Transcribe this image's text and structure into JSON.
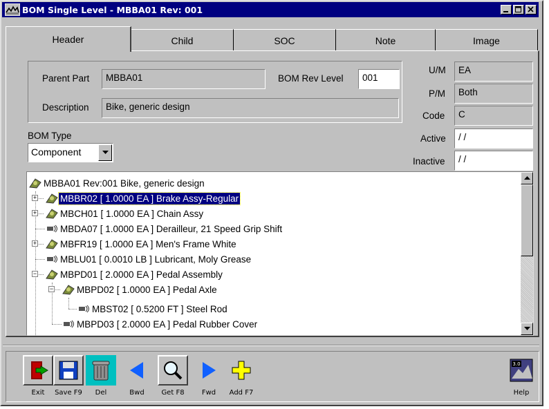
{
  "window": {
    "title": "BOM Single Level - MBBA01  Rev: 001"
  },
  "tabs": [
    {
      "label": "Header",
      "active": true
    },
    {
      "label": "Child",
      "active": false
    },
    {
      "label": "SOC",
      "active": false
    },
    {
      "label": "Note",
      "active": false
    },
    {
      "label": "Image",
      "active": false
    }
  ],
  "header": {
    "parent_part_label": "Parent Part",
    "parent_part_value": "MBBA01",
    "bom_rev_label": "BOM Rev Level",
    "bom_rev_value": "001",
    "description_label": "Description",
    "description_value": "Bike, generic design",
    "um_label": "U/M",
    "um_value": "EA",
    "pm_label": "P/M",
    "pm_value": "Both",
    "code_label": "Code",
    "code_value": "C",
    "active_label": "Active",
    "active_value": " / /",
    "inactive_label": "Inactive",
    "inactive_value": " / /",
    "bom_type_label": "BOM Type",
    "bom_type_value": "Component"
  },
  "tree": {
    "root": "MBBA01  Rev:001 Bike, generic design",
    "items": [
      {
        "text": "MBBR02 [ 1.0000 EA ] Brake Assy-Regular",
        "icon": "assembly-icon",
        "selected": true
      },
      {
        "text": "MBCH01 [ 1.0000 EA ] Chain Assy",
        "icon": "assembly-icon"
      },
      {
        "text": "MBDA07 [ 1.0000 EA ] Derailleur, 21 Speed Grip Shift",
        "icon": "part-icon"
      },
      {
        "text": "MBFR19 [ 1.0000 EA ] Men's Frame White",
        "icon": "assembly-icon"
      },
      {
        "text": "MBLU01 [ 0.0010 LB ] Lubricant, Moly Grease",
        "icon": "part-icon"
      },
      {
        "text": "MBPD01 [ 2.0000 EA ] Pedal Assembly",
        "icon": "assembly-icon"
      },
      {
        "text": "MBPD02 [ 1.0000 EA ] Pedal Axle",
        "icon": "assembly-icon"
      },
      {
        "text": "MBST02 [ 0.5200 FT ] Steel Rod",
        "icon": "part-icon"
      },
      {
        "text": "MBPD03 [ 2.0000 EA ] Pedal Rubber Cover",
        "icon": "part-icon"
      }
    ]
  },
  "toolbar": {
    "exit": "Exit",
    "save": "Save F9",
    "del": "Del",
    "bwd": "Bwd",
    "get": "Get F8",
    "fwd": "Fwd",
    "add": "Add F7",
    "help": "Help"
  },
  "colors": {
    "titlebar": "#000080",
    "face": "#c0c0c0",
    "selection": "#000080"
  }
}
